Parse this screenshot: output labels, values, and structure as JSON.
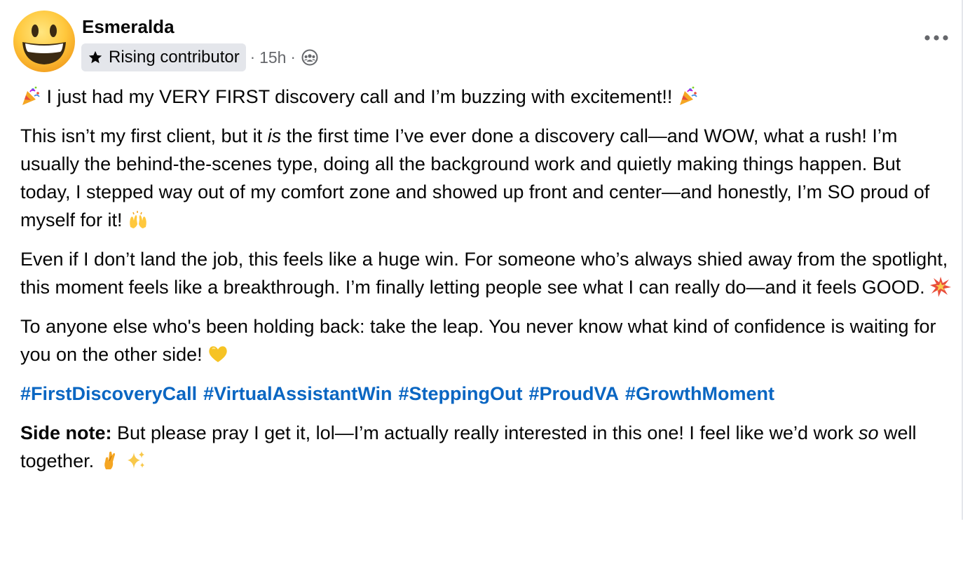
{
  "post": {
    "author": {
      "name": "Esmeralda",
      "avatar_icon": "grinning-face-emoji",
      "badge": {
        "icon": "star-icon",
        "label": "Rising contributor"
      }
    },
    "meta": {
      "separator": "·",
      "time": "15h",
      "audience_icon": "group-members-icon"
    },
    "more_icon": "more-options-icon",
    "paragraphs": {
      "p1": {
        "lead_emoji": "party-popper-emoji",
        "text": "I just had my VERY FIRST discovery call and I’m buzzing with excitement!!",
        "trail_emoji": "party-popper-emoji"
      },
      "p2": {
        "before": "This isn’t my first client, but it ",
        "italic": "is",
        "after": " the first time I’ve ever done a discovery call—and WOW, what a rush! I’m usually the behind-the-scenes type, doing all the background work and quietly making things happen. But today, I stepped way out of my comfort zone and showed up front and center—and honestly, I’m SO proud of myself for it!",
        "emoji": "raising-hands-emoji"
      },
      "p3": {
        "text": "Even if I don’t land the job, this feels like a huge win. For someone who’s always shied away from the spotlight, this moment feels like a breakthrough. I’m finally letting people see what I can really do—and it feels GOOD.",
        "emoji": "collision-emoji"
      },
      "p4": {
        "text": "To anyone else who's been holding back: take the leap. You never know what kind of confidence is waiting for you on the other side!",
        "emoji": "yellow-heart-emoji"
      },
      "hashtags": [
        "#FirstDiscoveryCall",
        "#VirtualAssistantWin",
        "#SteppingOut",
        "#ProudVA",
        "#GrowthMoment"
      ],
      "p5": {
        "label": "Side note:",
        "before": " But please pray I get it, lol—I’m actually really interested in this one! I feel like we’d work ",
        "italic": "so",
        "after": " well together.",
        "emojis": [
          "crossed-fingers-emoji",
          "sparkles-emoji"
        ]
      }
    },
    "colors": {
      "text": "#050505",
      "secondary_text": "#65676b",
      "badge_background": "#e4e6eb",
      "hashtag": "#0a66c2"
    }
  }
}
